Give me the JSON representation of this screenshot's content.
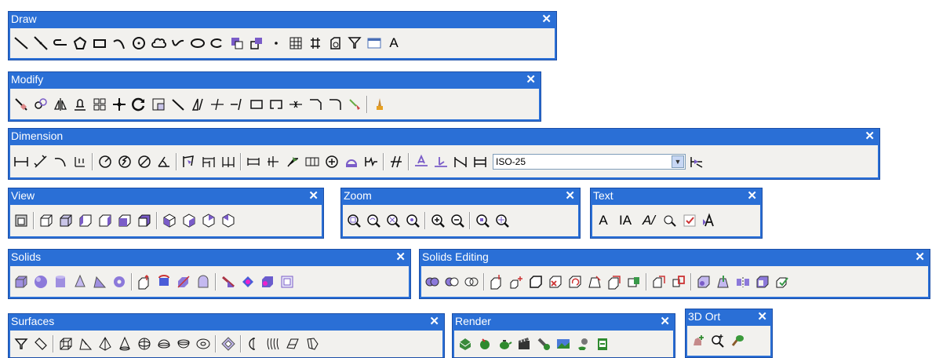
{
  "toolbars": {
    "draw": {
      "title": "Draw",
      "close": "✕"
    },
    "modify": {
      "title": "Modify",
      "close": "✕"
    },
    "dimension": {
      "title": "Dimension",
      "close": "✕",
      "style_value": "ISO-25"
    },
    "view": {
      "title": "View",
      "close": "✕"
    },
    "zoom": {
      "title": "Zoom",
      "close": "✕"
    },
    "text": {
      "title": "Text",
      "close": "✕"
    },
    "solids": {
      "title": "Solids",
      "close": "✕"
    },
    "solids_editing": {
      "title": "Solids Editing",
      "close": "✕"
    },
    "surfaces": {
      "title": "Surfaces",
      "close": "✕"
    },
    "render": {
      "title": "Render",
      "close": "✕"
    },
    "orbit": {
      "title": "3D Ort",
      "close": "✕"
    }
  },
  "glyphs": {
    "text_A": "A",
    "text_IA": "IA",
    "text_italic": "A/"
  },
  "colors": {
    "titlebar": "#2a6fd6",
    "toolbar_bg": "#f2f1ee",
    "icon_dark": "#1a1a1a",
    "icon_purple": "#7a5cc8"
  }
}
